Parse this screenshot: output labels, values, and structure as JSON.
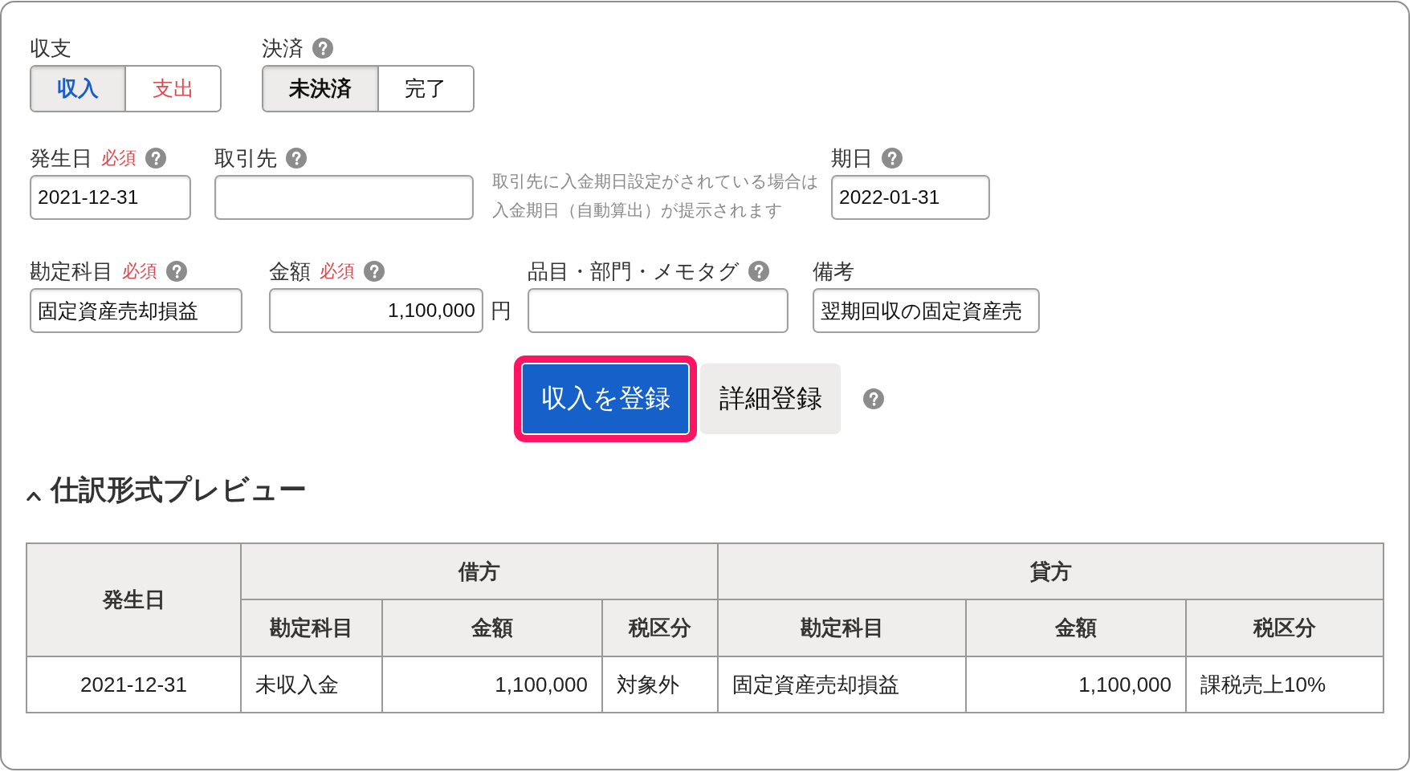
{
  "form_rows": [
    {
      "items": [
        {
          "kind": "segmented",
          "label": "収支",
          "help": false,
          "options": [
            {
              "label": "収入",
              "kind": "income",
              "selected": true
            },
            {
              "label": "支出",
              "kind": "expense",
              "selected": false
            }
          ]
        },
        {
          "kind": "segmented",
          "label": "決済",
          "help": true,
          "options": [
            {
              "label": "未決済",
              "kind": "plain",
              "selected": true
            },
            {
              "label": "完了",
              "kind": "plain",
              "selected": false
            }
          ]
        }
      ]
    },
    {
      "items": [
        {
          "kind": "field",
          "label": "発生日",
          "badge": "必須",
          "help": true,
          "value": "2021-12-31"
        },
        {
          "kind": "field",
          "label": "取引先",
          "help": true
        },
        {
          "kind": "note",
          "text": "取引先に入金期日設定がされている場合は入金期日（自動算出）が提示されます"
        },
        {
          "kind": "field",
          "label": "期日",
          "help": true,
          "value": "2022-01-31"
        }
      ]
    },
    {
      "items": [
        {
          "kind": "field",
          "label": "勘定科目",
          "badge": "必須",
          "help": true,
          "value": "固定資産売却損益"
        },
        {
          "kind": "amount",
          "label": "金額",
          "badge": "必須",
          "help": true,
          "value": "1,100,000",
          "unit": "円"
        },
        {
          "kind": "field",
          "label": "品目・部門・メモタグ",
          "help": true
        },
        {
          "kind": "field",
          "label": "備考",
          "help": false,
          "value": "翌期回収の固定資産売"
        }
      ]
    }
  ],
  "actions": {
    "buttons": [
      {
        "label": "収入を登録",
        "kind": "primary",
        "focused": true
      },
      {
        "label": "詳細登録",
        "kind": "secondary",
        "focused": false
      }
    ],
    "help": true
  },
  "preview": {
    "title": "仕訳形式プレビュー",
    "expanded": true,
    "table": {
      "first_column": {
        "label": "発生日",
        "kind": "date"
      },
      "groups": [
        {
          "label": "借方",
          "columns": [
            {
              "label": "勘定科目",
              "kind": "account"
            },
            {
              "label": "金額",
              "kind": "amount"
            },
            {
              "label": "税区分",
              "kind": "tax"
            }
          ]
        },
        {
          "label": "貸方",
          "columns": [
            {
              "label": "勘定科目",
              "kind": "account"
            },
            {
              "label": "金額",
              "kind": "amount"
            },
            {
              "label": "税区分",
              "kind": "tax"
            }
          ]
        }
      ],
      "rows": [
        {
          "cells": [
            "2021-12-31",
            "未収入金",
            "1,100,000",
            "対象外",
            "固定資産売却損益",
            "1,100,000",
            "課税売上10%"
          ]
        }
      ]
    }
  }
}
